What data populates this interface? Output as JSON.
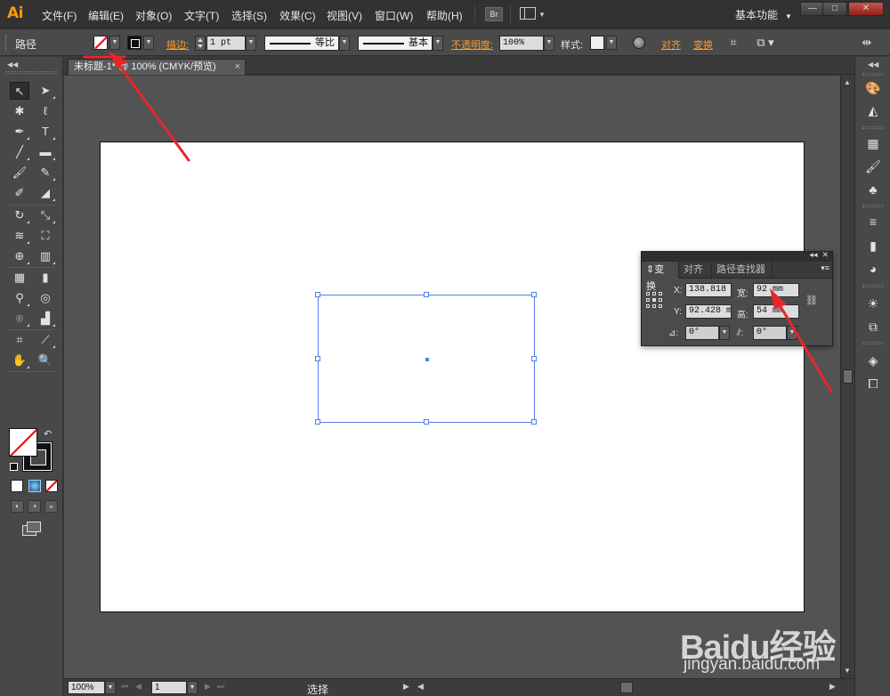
{
  "app": {
    "logo": "Ai"
  },
  "menu": {
    "items": [
      "文件(F)",
      "编辑(E)",
      "对象(O)",
      "文字(T)",
      "选择(S)",
      "效果(C)",
      "视图(V)",
      "窗口(W)",
      "帮助(H)"
    ],
    "bridge_label": "Br",
    "workspace": "基本功能",
    "window_buttons": [
      "—",
      "□",
      "✕"
    ]
  },
  "control_bar": {
    "selection_type": "路径",
    "stroke_label": "描边:",
    "stroke_weight": "1 pt",
    "profile_label": "等比",
    "brush_label": "基本",
    "opacity_label": "不透明度:",
    "opacity_value": "100%",
    "style_label": "样式:",
    "align_label": "对齐",
    "transform_label": "变换"
  },
  "document": {
    "tab_title": "未标题-1* @ 100% (CMYK/预览)",
    "tab_close": "×"
  },
  "status_bar": {
    "zoom": "100%",
    "artboard_number": "1",
    "current_tool": "选择"
  },
  "transform_panel": {
    "tabs": [
      "变换",
      "对齐",
      "路径查找器"
    ],
    "active_tab": "变换",
    "x_label": "X:",
    "x_value": "138.818",
    "y_label": "Y:",
    "y_value": "92.428 m",
    "width_label": "宽:",
    "width_value": "92 mm",
    "height_label": "高:",
    "height_value": "54 mm",
    "angle_value": "0°",
    "shear_value": "0°"
  },
  "watermark": {
    "title": "Baidu经验",
    "url": "jingyan.baidu.com"
  },
  "colors": {
    "accent_orange": "#ff9a00",
    "link_orange": "#ff9a28",
    "selection_blue": "#4f80e8",
    "annotation_red": "#e8262a"
  }
}
